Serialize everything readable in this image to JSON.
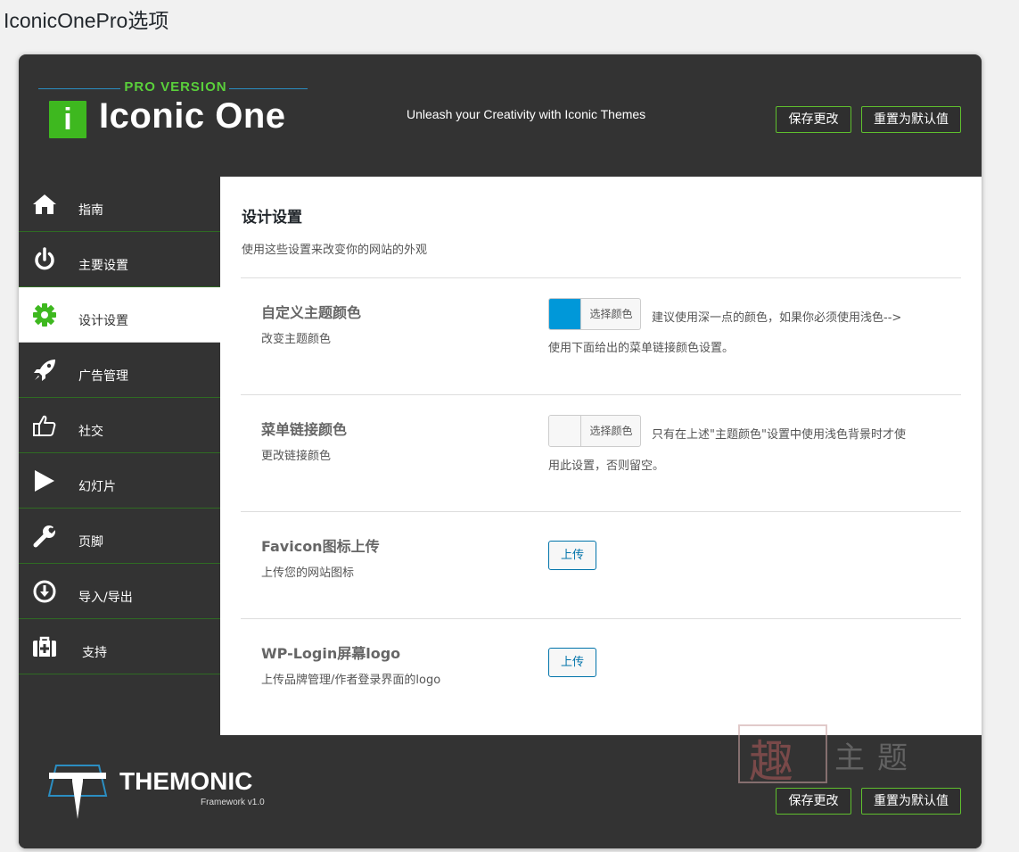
{
  "page": {
    "title": "IconicOnePro选项"
  },
  "header": {
    "logo_badge": "PRO VERSION",
    "logo_letter": "i",
    "logo_word": "Iconic One",
    "tagline": "Unleash your Creativity with Iconic Themes",
    "save_label": "保存更改",
    "reset_label": "重置为默认值"
  },
  "sidebar": {
    "items": [
      {
        "label": "指南",
        "icon": "home-icon"
      },
      {
        "label": "主要设置",
        "icon": "power-icon"
      },
      {
        "label": "设计设置",
        "icon": "gear-icon",
        "active": true
      },
      {
        "label": "广告管理",
        "icon": "rocket-icon"
      },
      {
        "label": "社交",
        "icon": "thumbs-up-icon"
      },
      {
        "label": "幻灯片",
        "icon": "play-icon"
      },
      {
        "label": "页脚",
        "icon": "wrench-icon"
      },
      {
        "label": "导入/导出",
        "icon": "download-icon"
      },
      {
        "label": "支持",
        "icon": "medkit-icon"
      }
    ]
  },
  "content": {
    "title": "设计设置",
    "description": "使用这些设置来改变你的网站的外观",
    "options": [
      {
        "title": "自定义主题颜色",
        "description": "改变主题颜色",
        "control": "color",
        "button_label": "选择颜色",
        "swatch_color": "#0098d9",
        "note_line1": "建议使用深一点的颜色，如果你必须使用浅色-->",
        "note_line2": "使用下面给出的菜单链接颜色设置。"
      },
      {
        "title": "菜单链接颜色",
        "description": "更改链接颜色",
        "control": "color",
        "button_label": "选择颜色",
        "swatch_color": "#f7f7f7",
        "note_line1": "只有在上述\"主题颜色\"设置中使用浅色背景时才使",
        "note_line2": "用此设置，否则留空。"
      },
      {
        "title": "Favicon图标上传",
        "description": "上传您的网站图标",
        "control": "upload",
        "button_label": "上传"
      },
      {
        "title": "WP-Login屏幕logo",
        "description": "上传品牌管理/作者登录界面的logo",
        "control": "upload",
        "button_label": "上传"
      }
    ]
  },
  "footer": {
    "brand": "THEMONIC",
    "version": "Framework v1.0",
    "save_label": "保存更改",
    "reset_label": "重置为默认值"
  },
  "watermark": {
    "char": "趣",
    "text": "主题"
  },
  "colors": {
    "accent_green": "#5fbf2e",
    "panel_bg": "#333333",
    "link_blue": "#0073aa"
  }
}
